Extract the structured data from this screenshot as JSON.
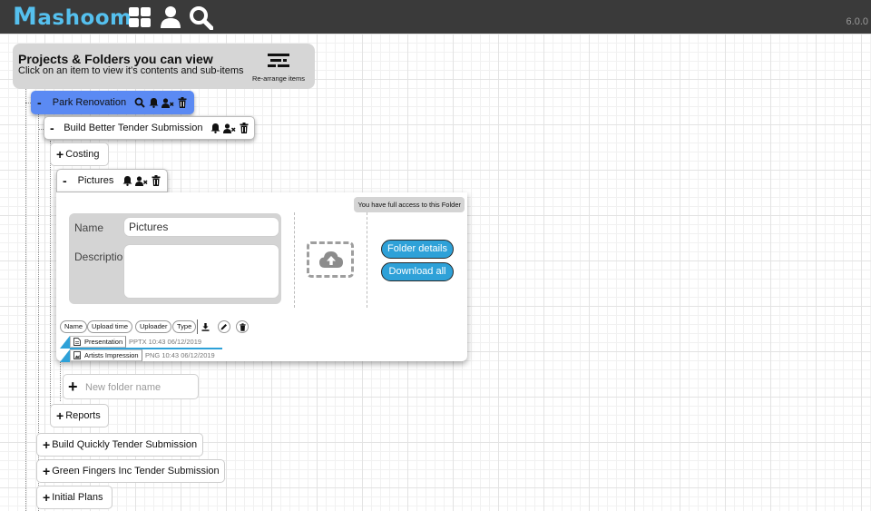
{
  "app": {
    "logo": "Mashoom",
    "version": "6.0.0",
    "top_icons": [
      "grid-icon",
      "user-icon",
      "search-icon"
    ]
  },
  "header": {
    "title": "Projects & Folders you can view",
    "subtitle": "Click on an item to view it's contents and sub-items",
    "rearrange_label": "Re-arrange items"
  },
  "tree": {
    "park": {
      "toggle": "-",
      "label": "Park Renovation"
    },
    "build_better": {
      "toggle": "-",
      "label": "Build Better Tender Submission"
    },
    "costing": {
      "toggle": "+",
      "label": "Costing"
    },
    "pictures": {
      "toggle": "-",
      "label": "Pictures"
    },
    "reports": {
      "toggle": "+",
      "label": "Reports"
    },
    "build_quickly": {
      "toggle": "+",
      "label": "Build Quickly Tender Submission"
    },
    "green_fingers": {
      "toggle": "+",
      "label": "Green Fingers Inc Tender Submission"
    },
    "initial_plans": {
      "toggle": "+",
      "label": "Initial Plans"
    }
  },
  "folder_panel": {
    "access_badge": "You have full access to this Folder",
    "name_label": "Name",
    "name_value": "Pictures",
    "description_label": "Description",
    "description_value": "",
    "details_button": "Folder details",
    "download_button": "Download all",
    "columns": [
      "Name",
      "Upload time",
      "Uploader",
      "Type"
    ],
    "files": [
      {
        "name": "Presentation",
        "meta": "PPTX 10:43 06/12/2019",
        "icon": "document-icon"
      },
      {
        "name": "Artists Impression",
        "meta": "PNG 10:43 06/12/2019",
        "icon": "image-icon"
      }
    ]
  },
  "new_folder": {
    "placeholder": "New folder name",
    "value": ""
  },
  "colors": {
    "topbar": "#3a3a3a",
    "logo": "#55c0ee",
    "selected": "#5b8af3",
    "accent": "#2ea1d8",
    "panel_grey": "#d6d6d6"
  }
}
